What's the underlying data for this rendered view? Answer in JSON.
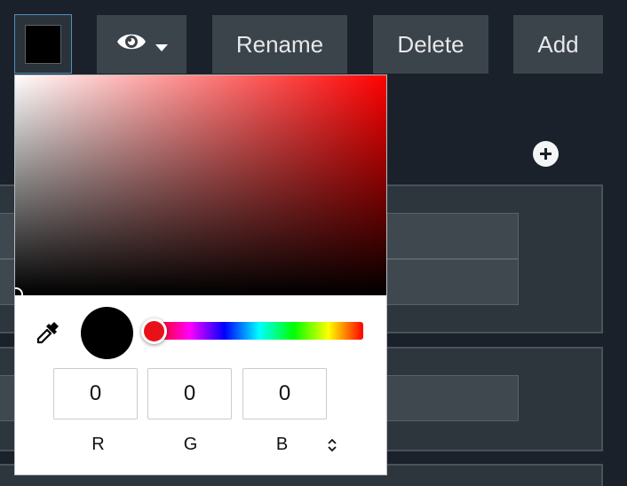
{
  "toolbar": {
    "rename_label": "Rename",
    "delete_label": "Delete",
    "add_label": "Add",
    "visibility_icon": "eye-icon",
    "dropdown_icon": "caret-down-icon"
  },
  "add_item_icon": "plus-circle-icon",
  "color_picker": {
    "current_color": "#000000",
    "hue_color": "#ff0000",
    "eyedropper_icon": "eyedropper-icon",
    "mode_toggle_icon": "chevron-up-down-icon",
    "channels": [
      {
        "label": "R",
        "value": "0"
      },
      {
        "label": "G",
        "value": "0"
      },
      {
        "label": "B",
        "value": "0"
      }
    ]
  },
  "colors": {
    "background": "#1a212a",
    "button": "#3b434b",
    "panel": "#2d353d",
    "swatch_border": "#4f8fbf"
  }
}
